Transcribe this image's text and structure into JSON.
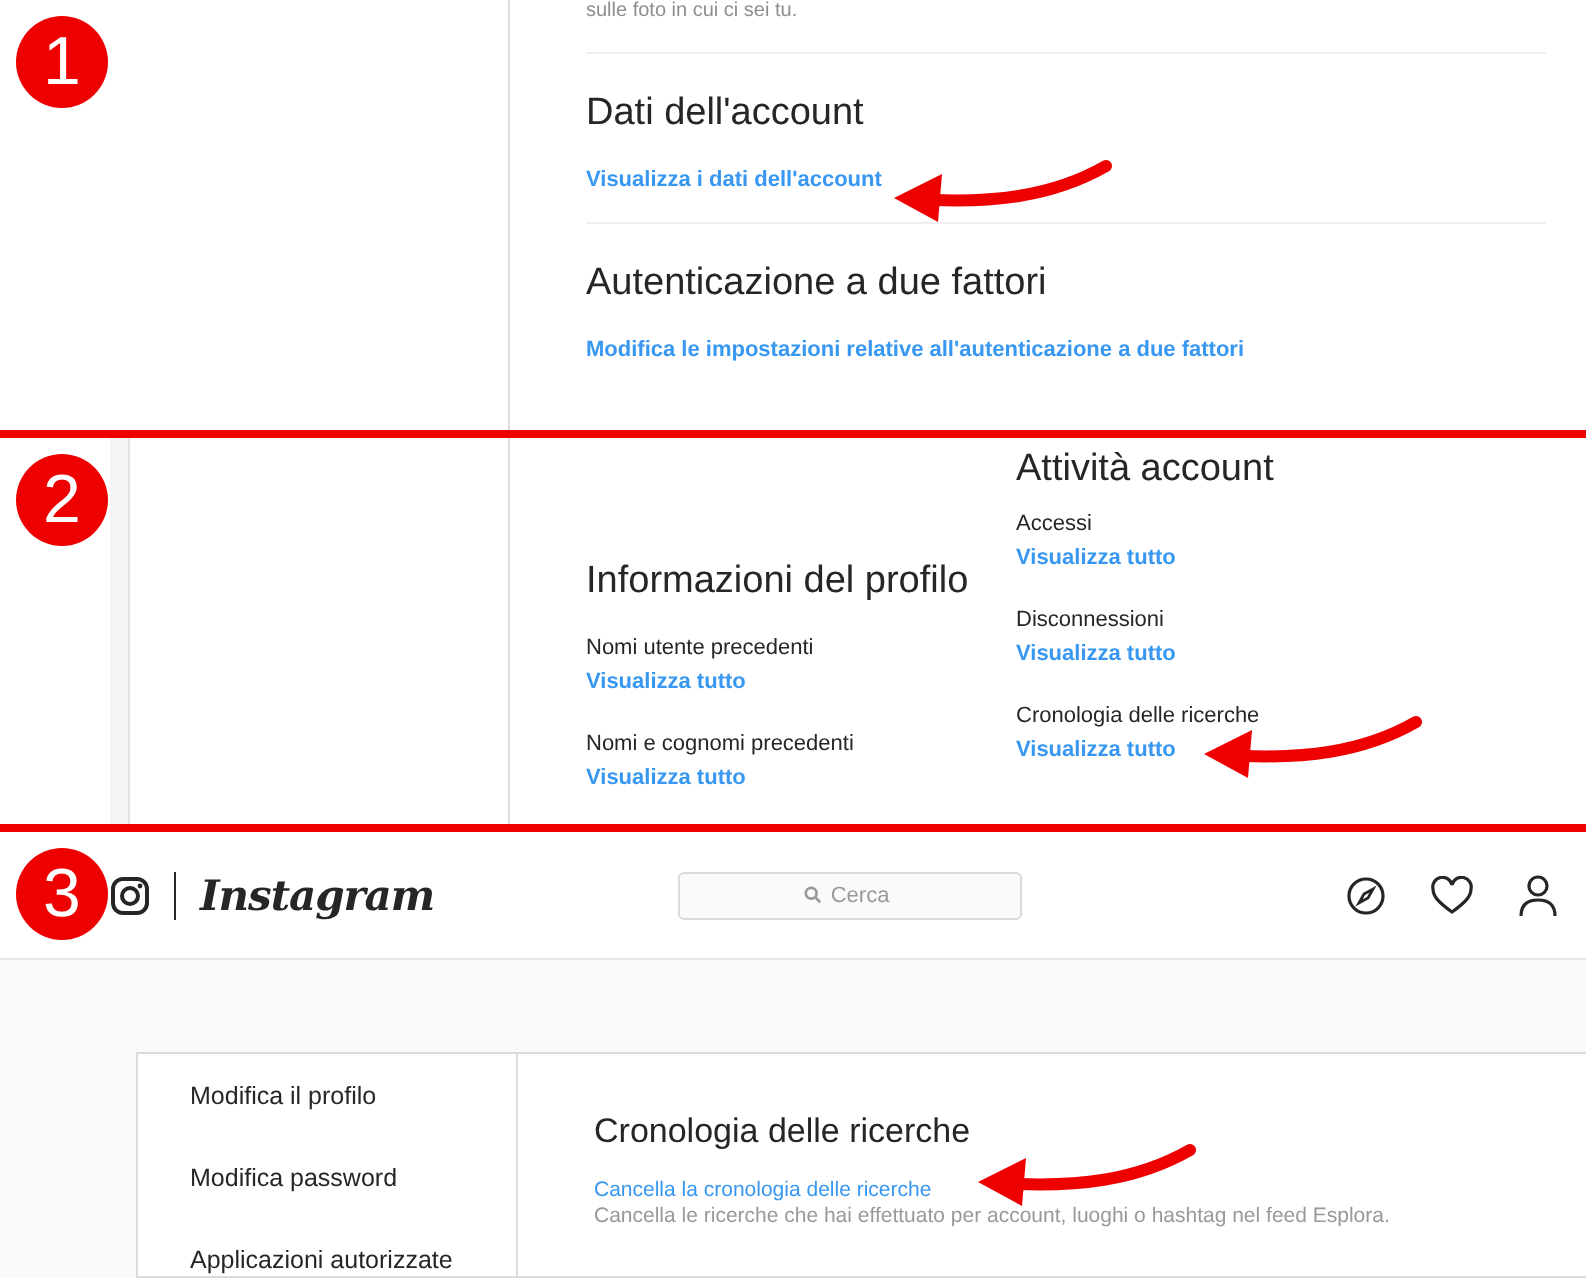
{
  "step_1": {
    "badge": "1",
    "intro": "sulle foto in cui ci sei tu.",
    "sections": [
      {
        "heading": "Dati dell'account",
        "link": "Visualizza i dati dell'account",
        "arrow": true
      },
      {
        "heading": "Autenticazione a due fattori",
        "link": "Modifica le impostazioni relative all'autenticazione a due fattori",
        "arrow": false
      }
    ]
  },
  "step_2": {
    "badge": "2",
    "profile_info": {
      "heading": "Informazioni del profilo",
      "items": [
        {
          "label": "Nomi utente precedenti",
          "link": "Visualizza tutto",
          "arrow": false
        },
        {
          "label": "Nomi e cognomi precedenti",
          "link": "Visualizza tutto",
          "arrow": false
        }
      ]
    },
    "account_activity": {
      "heading": "Attività account",
      "items": [
        {
          "label": "Accessi",
          "link": "Visualizza tutto",
          "arrow": false
        },
        {
          "label": "Disconnessioni",
          "link": "Visualizza tutto",
          "arrow": false
        },
        {
          "label": "Cronologia delle ricerche",
          "link": "Visualizza tutto",
          "arrow": true
        }
      ]
    }
  },
  "step_3": {
    "badge": "3",
    "brand": "Instagram",
    "search": {
      "placeholder": "Cerca"
    },
    "menu": [
      {
        "label": "Modifica il profilo"
      },
      {
        "label": "Modifica password"
      },
      {
        "label": "Applicazioni autorizzate"
      }
    ],
    "heading": "Cronologia delle ricerche",
    "link": "Cancella la cronologia delle ricerche",
    "description": "Cancella le ricerche che hai effettuato per account, luoghi o hashtag nel feed Esplora.",
    "arrow": true
  }
}
